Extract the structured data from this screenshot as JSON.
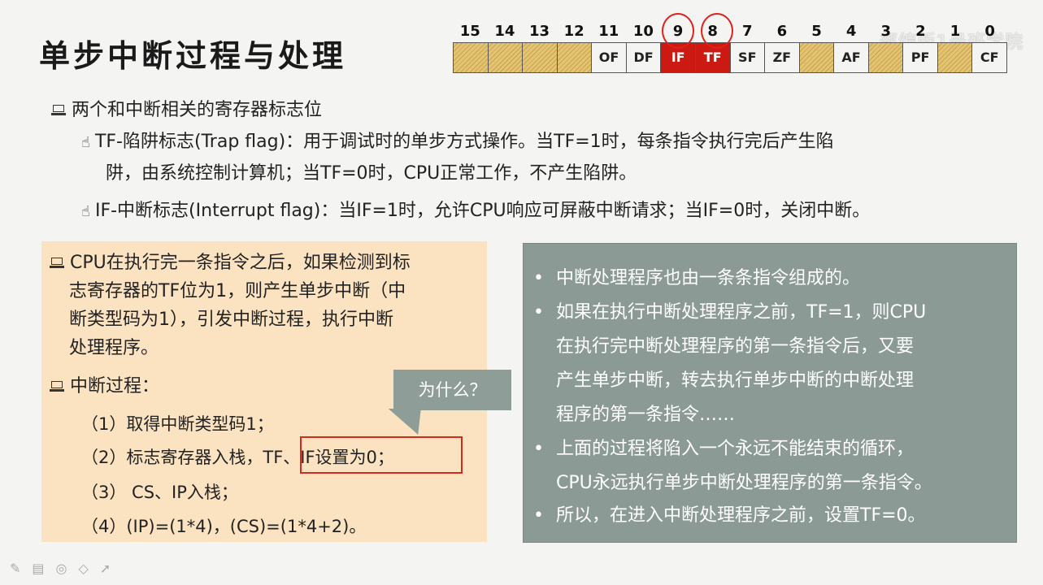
{
  "title": "单步中断过程与处理",
  "watermark": "部编版1号班学院",
  "register": {
    "bits": [
      "15",
      "14",
      "13",
      "12",
      "11",
      "10",
      "9",
      "8",
      "7",
      "6",
      "5",
      "4",
      "3",
      "2",
      "1",
      "0"
    ],
    "cells": [
      "",
      "",
      "",
      "",
      "OF",
      "DF",
      "IF",
      "TF",
      "SF",
      "ZF",
      "",
      "AF",
      "",
      "PF",
      "",
      "CF"
    ]
  },
  "section1": {
    "heading": "两个和中断相关的寄存器标志位",
    "tf_line1": "TF-陷阱标志(Trap flag)：用于调试时的单步方式操作。当TF=1时，每条指令执行完后产生陷",
    "tf_line2": "阱，由系统控制计算机；当TF=0时，CPU正常工作，不产生陷阱。",
    "if_line": "IF-中断标志(Interrupt flag)：当IF=1时，允许CPU响应可屏蔽中断请求；当IF=0时，关闭中断。"
  },
  "left_panel": {
    "p1_line1": "CPU在执行完一条指令之后，如果检测到标",
    "p1_line2": "志寄存器的TF位为1，则产生单步中断（中",
    "p1_line3": "断类型码为1），引发中断过程，执行中断",
    "p1_line4": "处理程序。",
    "p2_heading": "中断过程：",
    "steps": [
      "（1）取得中断类型码1；",
      "（2）标志寄存器入栈，TF、IF设置为0；",
      "（3） CS、IP入栈；",
      "（4）(IP)=(1*4)，(CS)=(1*4+2)。"
    ],
    "callout": "为什么？"
  },
  "right_panel": {
    "items": [
      [
        "中断处理程序也由一条条指令组成的。"
      ],
      [
        "如果在执行中断处理程序之前，TF=1，则CPU",
        "在执行完中断处理程序的第一条指令后，又要",
        "产生单步中断，转去执行单步中断的中断处理",
        "程序的第一条指令……"
      ],
      [
        "上面的过程将陷入一个永远不能结束的循环，",
        "CPU永远执行单步中断处理程序的第一条指令。"
      ],
      [
        "所以，在进入中断处理程序之前，设置TF=0。"
      ]
    ]
  },
  "toolbar": [
    "✎",
    "▤",
    "◎",
    "◇",
    "➚"
  ]
}
